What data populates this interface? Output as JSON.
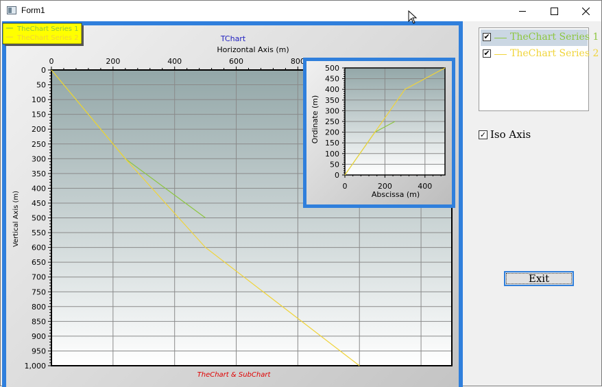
{
  "window": {
    "title": "Form1",
    "icon": "form-app-icon"
  },
  "colors": {
    "series1": "#8dc63f",
    "series2": "#f0d43a",
    "accent": "#2f7fdc",
    "chart_title": "#2020c0",
    "footer": "#e00000"
  },
  "chart_legend": {
    "items": [
      {
        "label": "TheChart Series 1"
      },
      {
        "label": "TheChart Series 2"
      }
    ]
  },
  "side_legend": {
    "items": [
      {
        "label": "TheChart Series 1",
        "checked": true
      },
      {
        "label": "TheChart Series 2",
        "checked": true
      }
    ]
  },
  "iso_axis": {
    "label": "Iso Axis",
    "checked": true
  },
  "exit_button": {
    "label": "Exit"
  },
  "chart_data": [
    {
      "type": "line",
      "title": "TChart",
      "xlabel": "Horizontal Axis (m)",
      "ylabel": "Vertical Axis (m)",
      "footer": "TheChart & SubChart",
      "xlim": [
        0,
        1300
      ],
      "ylim": [
        0,
        1000
      ],
      "y_inverted": true,
      "x_ticks": [
        0,
        200,
        400,
        600,
        800
      ],
      "y_ticks": [
        "0",
        "50",
        "100",
        "150",
        "200",
        "250",
        "300",
        "350",
        "400",
        "450",
        "500",
        "550",
        "600",
        "650",
        "700",
        "750",
        "800",
        "850",
        "900",
        "950",
        "1,000"
      ],
      "grid": true,
      "legend": "top-left",
      "series": [
        {
          "name": "TheChart Series 1",
          "x": [
            0,
            240,
            500
          ],
          "y": [
            0,
            300,
            500
          ]
        },
        {
          "name": "TheChart Series 2",
          "x": [
            0,
            240,
            500,
            1000
          ],
          "y": [
            0,
            300,
            600,
            1000
          ]
        }
      ]
    },
    {
      "type": "line",
      "xlabel": "Abscissa (m)",
      "ylabel": "Ordinate (m)",
      "xlim": [
        0,
        500
      ],
      "ylim": [
        0,
        500
      ],
      "x_ticks": [
        "0",
        "200",
        "400"
      ],
      "y_ticks": [
        "0",
        "50",
        "100",
        "150",
        "200",
        "250",
        "300",
        "350",
        "400",
        "450",
        "500"
      ],
      "grid": true,
      "series": [
        {
          "name": "TheChart Series 1",
          "x": [
            0,
            150,
            250
          ],
          "y": [
            0,
            200,
            250
          ]
        },
        {
          "name": "TheChart Series 2",
          "x": [
            0,
            150,
            300,
            500
          ],
          "y": [
            0,
            200,
            400,
            500
          ]
        }
      ]
    }
  ]
}
